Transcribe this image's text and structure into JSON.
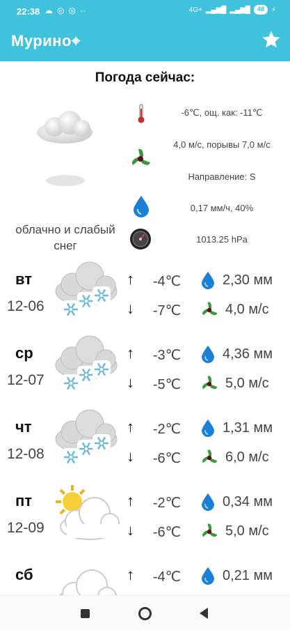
{
  "status": {
    "time": "22:38",
    "net_label": "4G+",
    "battery": "48"
  },
  "app": {
    "title": "Мурино⌖",
    "favorite_icon": "star-icon"
  },
  "now": {
    "heading": "Погода сейчас:",
    "temperature": "-6℃, ощ. как: -11℃",
    "wind": "4,0 м/с, порывы 7,0 м/с",
    "direction": "Направление: S",
    "precip": "0,17 мм/ч, 40%",
    "pressure": "1013.25 hPa",
    "condition": "облачно и слабый снег"
  },
  "forecast": [
    {
      "day": "вт",
      "date": "12-06",
      "icon": "snow-cloud-icon",
      "tmax": "-4℃",
      "tmin": "-7℃",
      "precip": "2,30 мм",
      "wind": "4,0 м/с"
    },
    {
      "day": "ср",
      "date": "12-07",
      "icon": "snow-cloud-icon",
      "tmax": "-3℃",
      "tmin": "-5℃",
      "precip": "4,36 мм",
      "wind": "5,0 м/с"
    },
    {
      "day": "чт",
      "date": "12-08",
      "icon": "snow-cloud-icon",
      "tmax": "-2℃",
      "tmin": "-6℃",
      "precip": "1,31 мм",
      "wind": "6,0 м/с"
    },
    {
      "day": "пт",
      "date": "12-09",
      "icon": "sun-cloud-icon",
      "tmax": "-2℃",
      "tmin": "-6℃",
      "precip": "0,34 мм",
      "wind": "5,0 м/с"
    },
    {
      "day": "сб",
      "date": "",
      "icon": "cloud-icon",
      "tmax": "-4℃",
      "tmin": "",
      "precip": "0,21 мм",
      "wind": ""
    }
  ],
  "colors": {
    "accent": "#3fc2dc",
    "drop": "#1a7fd6",
    "fan_green": "#3a9a3a",
    "fan_dark": "#5a1020"
  }
}
